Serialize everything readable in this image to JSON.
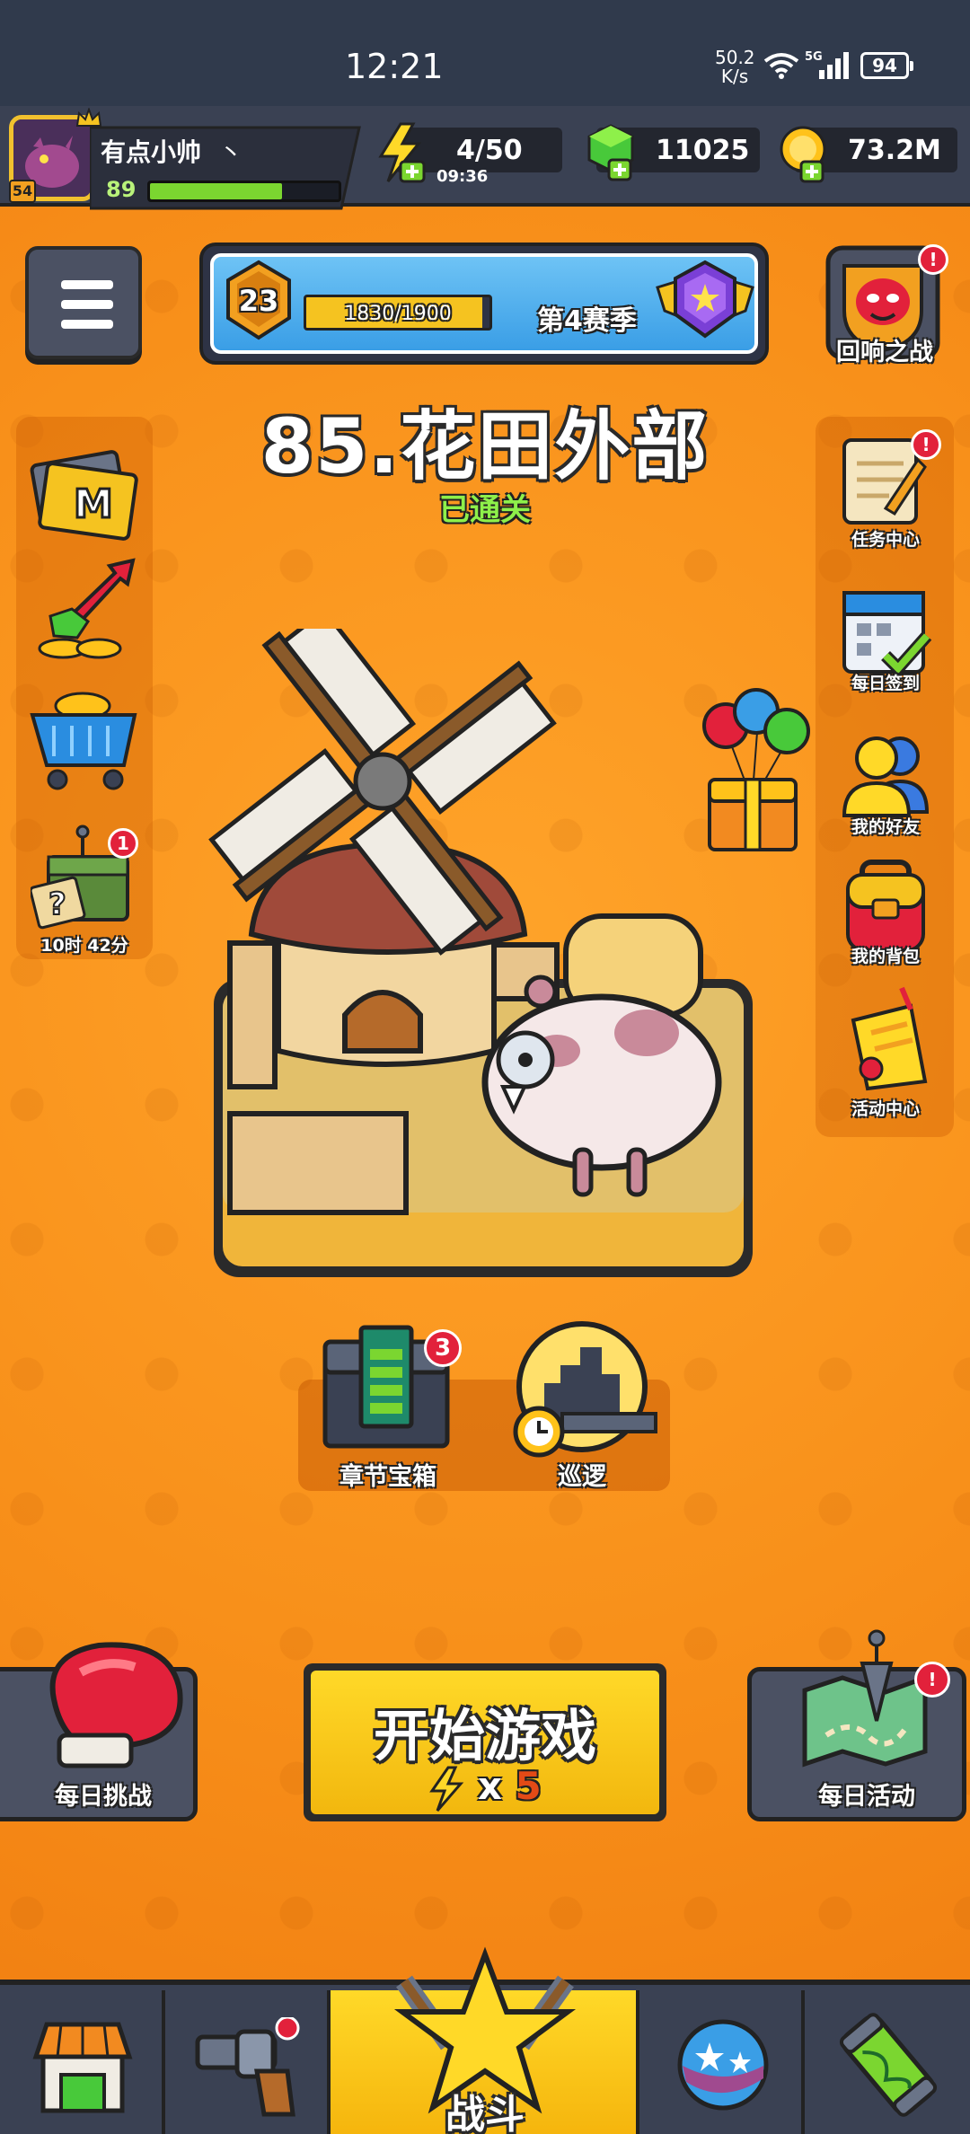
{
  "status_bar": {
    "time": "12:21",
    "net_speed_value": "50.2",
    "net_speed_unit": "K/s",
    "network_type": "5G",
    "battery": "94"
  },
  "player": {
    "name": "有点小帅",
    "name_suffix": "丶",
    "level": "89",
    "avatar_level": "54",
    "xp_progress": 0.7
  },
  "resources": {
    "energy": "4/50",
    "energy_timer": "09:36",
    "gems": "11025",
    "coins": "73.2M"
  },
  "season": {
    "rank": "23",
    "progress_text": "1830/1900",
    "progress": 0.963,
    "label": "第4赛季"
  },
  "right_top": {
    "label": "回响之战",
    "has_alert": "!"
  },
  "stage": {
    "title": "85.花田外部",
    "status": "已通关"
  },
  "left_menu": {
    "supply_timer": "10时 42分",
    "supply_badge": "1"
  },
  "right_menu": [
    {
      "label": "任务中心",
      "badge": "!"
    },
    {
      "label": "每日签到",
      "badge": ""
    },
    {
      "label": "我的好友",
      "badge": ""
    },
    {
      "label": "我的背包",
      "badge": ""
    },
    {
      "label": "活动中心",
      "badge": ""
    }
  ],
  "chest": {
    "label": "章节宝箱",
    "badge": "3"
  },
  "patrol": {
    "label": "巡逻"
  },
  "start": {
    "label": "开始游戏",
    "cost_prefix": "x",
    "cost_value": "5"
  },
  "daily_challenge": {
    "label": "每日挑战"
  },
  "daily_event": {
    "label": "每日活动",
    "badge": "!"
  },
  "tabs": {
    "active_label": "战斗"
  },
  "colors": {
    "background": "#f7931a",
    "hud": "#3a4153",
    "accent_yellow": "#ffd928",
    "xp_green": "#7bd630",
    "badge_red": "#e2213b"
  }
}
